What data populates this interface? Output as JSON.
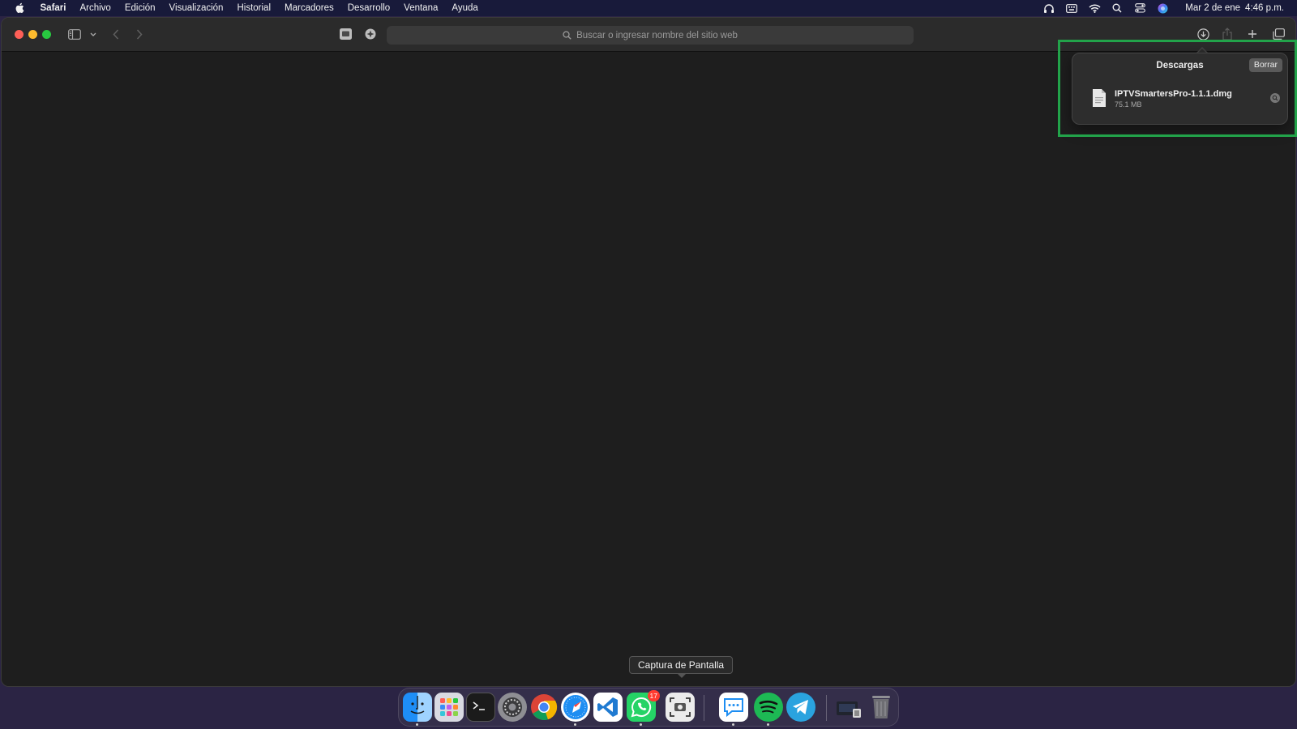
{
  "menubar": {
    "apple_icon": "apple-logo-icon",
    "app_name": "Safari",
    "items": [
      "Archivo",
      "Edición",
      "Visualización",
      "Historial",
      "Marcadores",
      "Desarrollo",
      "Ventana",
      "Ayuda"
    ],
    "status_icons": [
      "headphones-icon",
      "keyboard-input-icon",
      "wifi-icon",
      "spotlight-search-icon",
      "control-center-icon",
      "siri-icon"
    ],
    "date": "Mar 2 de ene",
    "time": "4:46 p.m."
  },
  "toolbar": {
    "address_placeholder": "Buscar o ingresar nombre del sitio web",
    "icons": [
      "sidebar-icon",
      "chevron-down-icon",
      "back-icon",
      "forward-icon",
      "reader-icon",
      "extension-icon",
      "downloads-icon",
      "share-icon",
      "new-tab-icon",
      "tabs-overview-icon"
    ]
  },
  "downloads": {
    "title": "Descargas",
    "clear_label": "Borrar",
    "items": [
      {
        "name": "IPTVSmartersPro-1.1.1.dmg",
        "size": "75.1 MB"
      }
    ]
  },
  "tooltip": {
    "text": "Captura de Pantalla"
  },
  "dock": {
    "apps": [
      "finder",
      "launchpad",
      "terminal",
      "system-settings",
      "chrome",
      "safari",
      "vscode",
      "whatsapp",
      "screenshot",
      "chat",
      "spotify",
      "telegram",
      "downloads-stack",
      "trash"
    ],
    "whatsapp_badge": "17"
  },
  "colors": {
    "menubar_bg": "#181a3a",
    "window_bg": "#1e1e1e",
    "toolbar_bg": "#2b2b2b",
    "highlight": "#22a34a"
  }
}
